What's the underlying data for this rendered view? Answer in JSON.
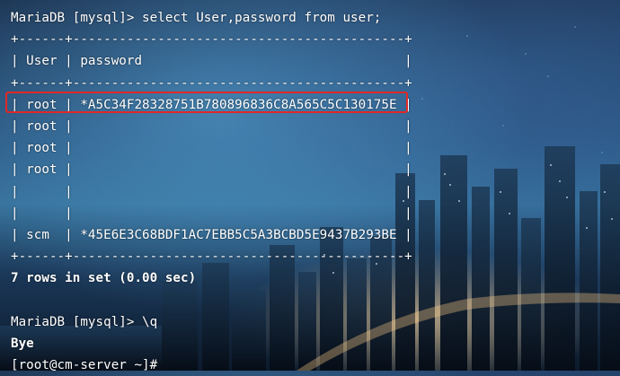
{
  "terminal": {
    "lines": [
      "MariaDB [mysql]> select User,password from user;",
      "+------+-------------------------------------------+",
      "| User | password                                  |",
      "+------+-------------------------------------------+",
      "| root | *A5C34F28328751B780896836C8A565C5C130175E |",
      "| root |                                           |",
      "| root |                                           |",
      "| root |                                           |",
      "|      |                                           |",
      "|      |                                           |",
      "| scm  | *45E6E3C68BDF1AC7EBB5C5A3BCBD5E9437B293BE |",
      "+------+-------------------------------------------+",
      "7 rows in set (0.00 sec)",
      "",
      "MariaDB [mysql]> \\q",
      "Bye",
      "[root@cm-server ~]#"
    ]
  },
  "colors": {
    "text": "#ffffff",
    "highlight": "#e02828"
  }
}
